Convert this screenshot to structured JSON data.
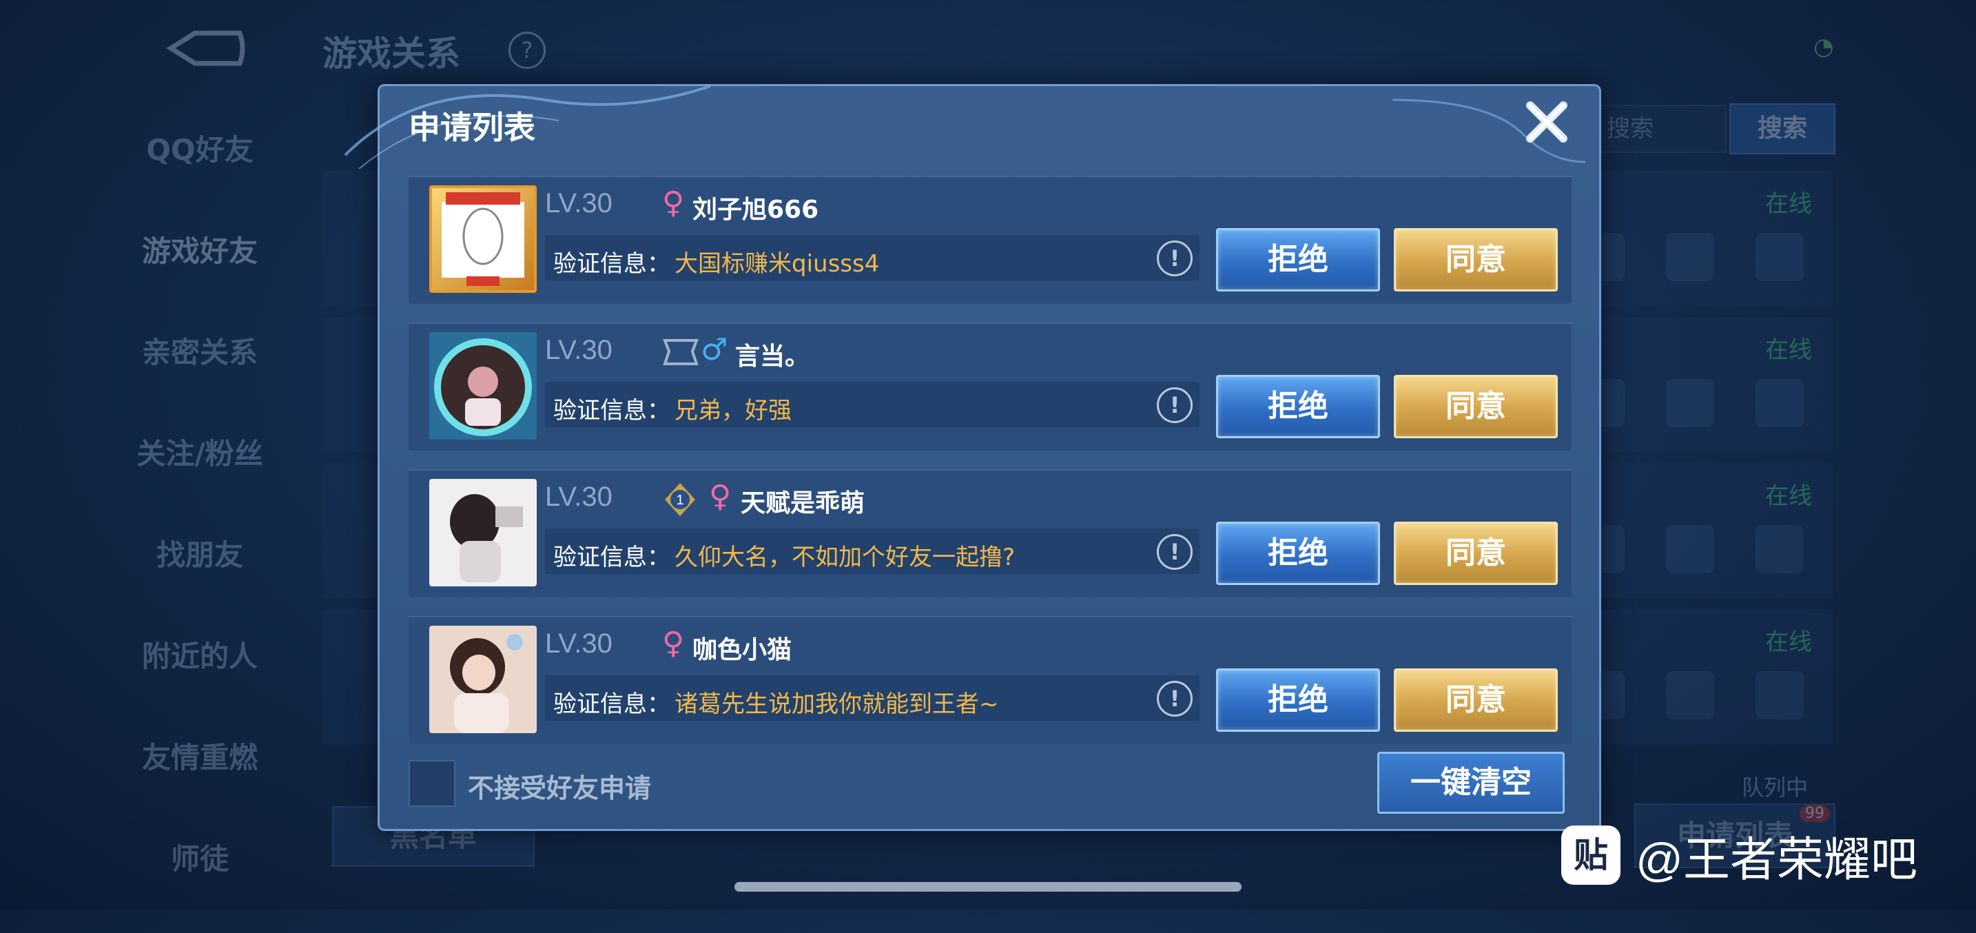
{
  "background": {
    "title": "游戏关系",
    "help_glyph": "?",
    "search_placeholder": "搜索",
    "search_button": "搜索",
    "sidebar": [
      {
        "label": "QQ好友"
      },
      {
        "label": "游戏好友"
      },
      {
        "label": "亲密关系"
      },
      {
        "label": "关注/粉丝"
      },
      {
        "label": "找朋友"
      },
      {
        "label": "附近的人"
      },
      {
        "label": "友情重燃"
      },
      {
        "label": "师徒"
      }
    ],
    "row_status": [
      "在线",
      "在线",
      "在线",
      "在线"
    ],
    "blacklist_button": "黑名单",
    "queue_text": "队列中",
    "apply_list_button": "申请列表",
    "apply_badge": "99"
  },
  "dialog": {
    "title": "申请列表",
    "verify_label": "验证信息：",
    "reject_label": "拒绝",
    "agree_label": "同意",
    "requests": [
      {
        "level": "LV.30",
        "gender": "female",
        "gender_glyph": "♀",
        "name": "刘子旭666",
        "message": "大国标赚米qiusss4",
        "avatar": "kpl-avatar"
      },
      {
        "level": "LV.30",
        "gender": "male",
        "gender_glyph": "♂",
        "name": "言当。",
        "message": "兄弟，好强",
        "avatar": "frame-avatar"
      },
      {
        "level": "LV.30",
        "gender": "female",
        "gender_glyph": "♀",
        "name": "天赋是乖萌",
        "message": "久仰大名，不如加个好友一起撸?",
        "avatar": "girl-avatar",
        "rank_badge": "1"
      },
      {
        "level": "LV.30",
        "gender": "female",
        "gender_glyph": "♀",
        "name": "咖色小猫",
        "message": "诸葛先生说加我你就能到王者~",
        "avatar": "girl2-avatar"
      }
    ],
    "footer": {
      "reject_all_label": "不接受好友申请",
      "clear_button": "一键清空"
    }
  },
  "watermark": {
    "logo_glyph": "贴",
    "text": "@王者荣耀吧"
  },
  "colors": {
    "accent_gold": "#f2b74a",
    "reject_blue": "#2f6fc7",
    "agree_gold": "#d8a850",
    "female_pink": "#f06aa6",
    "male_blue": "#48aff0"
  }
}
